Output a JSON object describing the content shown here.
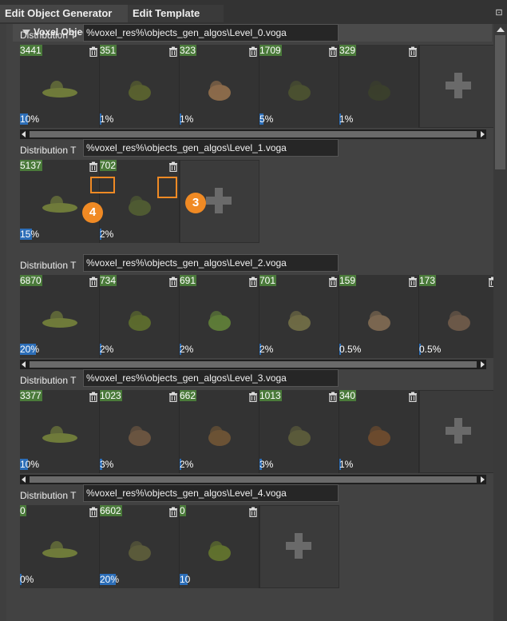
{
  "tabs": [
    {
      "label": "Edit Object Generator"
    },
    {
      "label": "Edit Template"
    }
  ],
  "section": {
    "title": "Voxel Object Generator Parameters"
  },
  "groups": [
    {
      "label": "Distribution T",
      "path": "%voxel_res%\\objects_gen_algos\\Level_0.voga",
      "items": [
        {
          "count": "3441",
          "percent": "10%",
          "level": 0.1
        },
        {
          "count": "351",
          "percent": "1%",
          "level": 0.01
        },
        {
          "count": "323",
          "percent": "1%",
          "level": 0.01
        },
        {
          "count": "1709",
          "percent": "5%",
          "level": 0.05
        },
        {
          "count": "329",
          "percent": "1%",
          "level": 0.01
        }
      ]
    },
    {
      "label": "Distribution T",
      "path": "%voxel_res%\\objects_gen_algos\\Level_1.voga",
      "items": [
        {
          "count": "5137",
          "percent": "15%",
          "level": 0.15
        },
        {
          "count": "702",
          "percent": "2%",
          "level": 0.02
        }
      ]
    },
    {
      "label": "Distribution T",
      "path": "%voxel_res%\\objects_gen_algos\\Level_2.voga",
      "items": [
        {
          "count": "6870",
          "percent": "20%",
          "level": 0.2
        },
        {
          "count": "734",
          "percent": "2%",
          "level": 0.02
        },
        {
          "count": "691",
          "percent": "2%",
          "level": 0.02
        },
        {
          "count": "701",
          "percent": "2%",
          "level": 0.02
        },
        {
          "count": "159",
          "percent": "0.5%",
          "level": 0.005
        },
        {
          "count": "173",
          "percent": "0.5%",
          "level": 0.005
        }
      ]
    },
    {
      "label": "Distribution T",
      "path": "%voxel_res%\\objects_gen_algos\\Level_3.voga",
      "items": [
        {
          "count": "3377",
          "percent": "10%",
          "level": 0.1
        },
        {
          "count": "1023",
          "percent": "3%",
          "level": 0.03
        },
        {
          "count": "662",
          "percent": "2%",
          "level": 0.02
        },
        {
          "count": "1013",
          "percent": "3%",
          "level": 0.03
        },
        {
          "count": "340",
          "percent": "1%",
          "level": 0.01
        }
      ]
    },
    {
      "label": "Distribution T",
      "path": "%voxel_res%\\objects_gen_algos\\Level_4.voga",
      "items": [
        {
          "count": "0",
          "percent": "0%",
          "level": 0
        },
        {
          "count": "6602",
          "percent": "20%",
          "level": 0.2
        },
        {
          "count": "0",
          "percent": "10",
          "level": 0.1
        }
      ]
    }
  ],
  "annotations": [
    {
      "number": "3"
    },
    {
      "number": "4"
    }
  ],
  "colors": {
    "accent": "#f08a24",
    "count_bg": "#4a7a3a",
    "percent_bar": "#2c6eb8"
  },
  "icons": {
    "trash": "trash-icon",
    "add": "plus-icon",
    "collapse": "triangle-down-icon",
    "pin": "pin-icon"
  }
}
